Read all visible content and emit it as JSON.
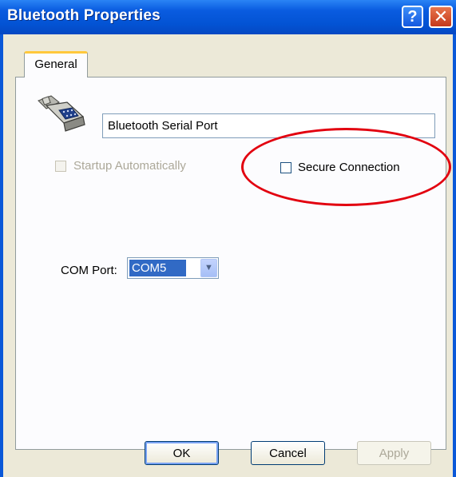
{
  "window": {
    "title": "Bluetooth Properties",
    "help_glyph": "?",
    "close_glyph": "✕"
  },
  "tabs": [
    {
      "label": "General",
      "selected": true
    }
  ],
  "general": {
    "service_name": "Bluetooth Serial Port",
    "startup_automatically": {
      "label": "Startup Automatically",
      "checked": false,
      "enabled": false
    },
    "secure_connection": {
      "label": "Secure Connection",
      "checked": false,
      "enabled": true
    },
    "com_port": {
      "label": "COM Port:",
      "value": "COM5"
    }
  },
  "buttons": {
    "ok": "OK",
    "cancel": "Cancel",
    "apply": "Apply"
  },
  "annotation": {
    "color": "#e2000f"
  }
}
